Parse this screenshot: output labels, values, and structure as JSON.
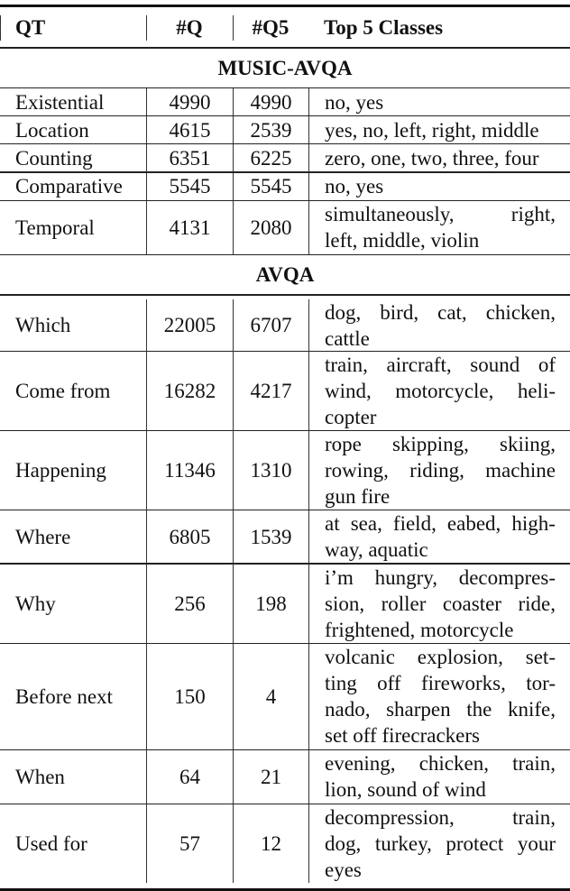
{
  "table": {
    "headers": [
      "QT",
      "#Q",
      "#Q5",
      "Top 5 Classes"
    ],
    "sections": [
      {
        "title": "MUSIC-AVQA",
        "rows": [
          {
            "qt": "Existential",
            "q": "4990",
            "q5": "4990",
            "classes": [
              "no, yes"
            ]
          },
          {
            "qt": "Location",
            "q": "4615",
            "q5": "2539",
            "classes": [
              "yes, no, left, right, middle"
            ]
          },
          {
            "qt": "Counting",
            "q": "6351",
            "q5": "6225",
            "classes": [
              "zero, one, two, three, four"
            ]
          },
          {
            "qt": "Comparative",
            "q": "5545",
            "q5": "5545",
            "classes": [
              "no, yes"
            ]
          },
          {
            "qt": "Temporal",
            "q": "4131",
            "q5": "2080",
            "classes": [
              "simultaneously, right,",
              "left, middle, violin"
            ]
          }
        ]
      },
      {
        "title": "AVQA",
        "rows": [
          {
            "qt": "Which",
            "q": "22005",
            "q5": "6707",
            "classes": [
              "dog, bird, cat, chicken,",
              "cattle"
            ]
          },
          {
            "qt": "Come from",
            "q": "16282",
            "q5": "4217",
            "classes": [
              "train, aircraft, sound of",
              "wind, motorcycle, heli-",
              "copter"
            ]
          },
          {
            "qt": "Happening",
            "q": "11346",
            "q5": "1310",
            "classes": [
              "rope skipping, skiing,",
              "rowing, riding, machine",
              "gun fire"
            ]
          },
          {
            "qt": "Where",
            "q": "6805",
            "q5": "1539",
            "classes": [
              "at sea, field, eabed, high-",
              "way, aquatic"
            ]
          },
          {
            "qt": "Why",
            "q": "256",
            "q5": "198",
            "classes": [
              "i’m hungry, decompres-",
              "sion, roller coaster ride,",
              "frightened, motorcycle"
            ]
          },
          {
            "qt": "Before next",
            "q": "150",
            "q5": "4",
            "classes": [
              "volcanic explosion, set-",
              "ting off fireworks, tor-",
              "nado, sharpen the knife,",
              "set off firecrackers"
            ]
          },
          {
            "qt": "When",
            "q": "64",
            "q5": "21",
            "classes": [
              "evening, chicken, train,",
              "lion, sound of wind"
            ]
          },
          {
            "qt": "Used for",
            "q": "57",
            "q5": "12",
            "classes": [
              "decompression, train,",
              "dog, turkey, protect your",
              "eyes"
            ]
          }
        ]
      }
    ]
  }
}
